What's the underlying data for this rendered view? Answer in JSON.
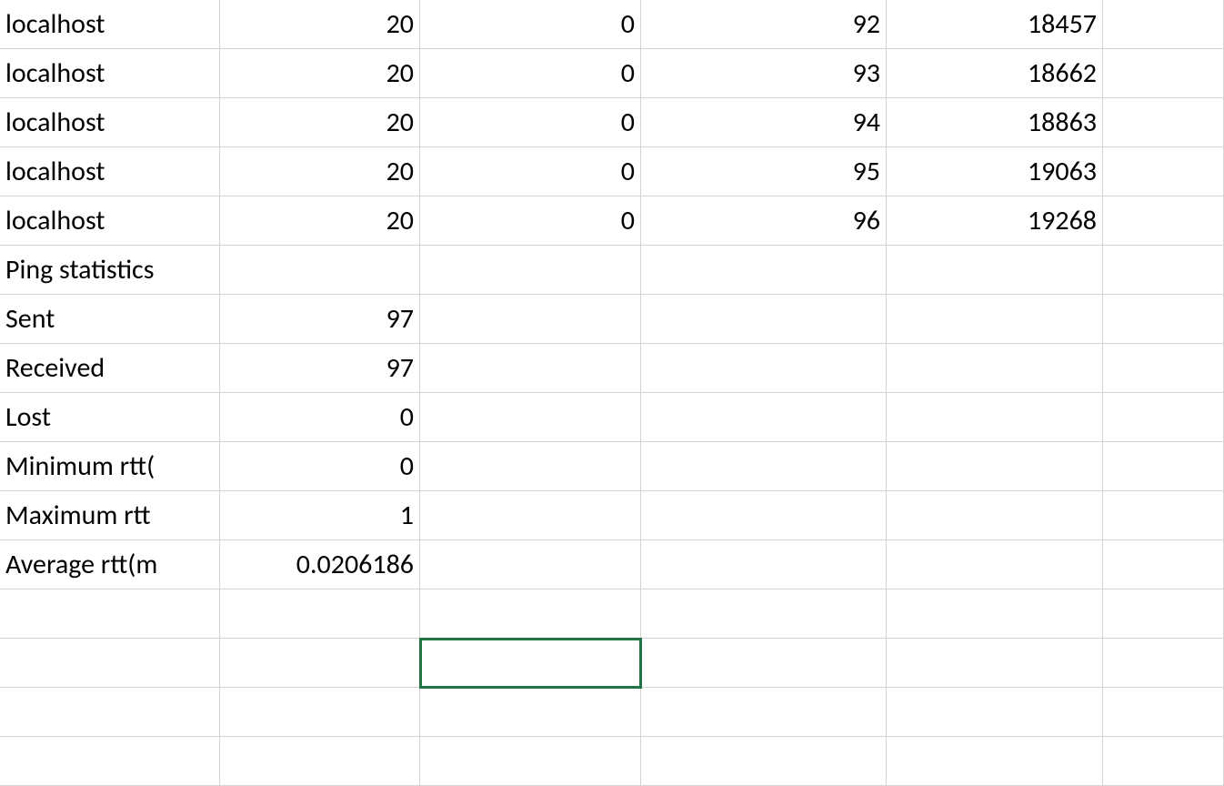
{
  "rows": [
    {
      "a": "localhost",
      "b": "20",
      "c": "0",
      "d": "92",
      "e": "18457",
      "f": ""
    },
    {
      "a": "localhost",
      "b": "20",
      "c": "0",
      "d": "93",
      "e": "18662",
      "f": ""
    },
    {
      "a": "localhost",
      "b": "20",
      "c": "0",
      "d": "94",
      "e": "18863",
      "f": ""
    },
    {
      "a": "localhost",
      "b": "20",
      "c": "0",
      "d": "95",
      "e": "19063",
      "f": ""
    },
    {
      "a": "localhost",
      "b": "20",
      "c": "0",
      "d": "96",
      "e": "19268",
      "f": ""
    },
    {
      "a": "Ping statistics",
      "b": "",
      "c": "",
      "d": "",
      "e": "",
      "f": ""
    },
    {
      "a": "Sent",
      "b": "97",
      "c": "",
      "d": "",
      "e": "",
      "f": ""
    },
    {
      "a": "Received",
      "b": "97",
      "c": "",
      "d": "",
      "e": "",
      "f": ""
    },
    {
      "a": "Lost",
      "b": "0",
      "c": "",
      "d": "",
      "e": "",
      "f": ""
    },
    {
      "a": "Minimum rtt(",
      "b": "0",
      "c": "",
      "d": "",
      "e": "",
      "f": ""
    },
    {
      "a": "Maximum rtt",
      "b": "1",
      "c": "",
      "d": "",
      "e": "",
      "f": ""
    },
    {
      "a": "Average rtt(m",
      "b": "0.0206186",
      "c": "",
      "d": "",
      "e": "",
      "f": ""
    },
    {
      "a": "",
      "b": "",
      "c": "",
      "d": "",
      "e": "",
      "f": ""
    },
    {
      "a": "",
      "b": "",
      "c": "",
      "d": "",
      "e": "",
      "f": ""
    },
    {
      "a": "",
      "b": "",
      "c": "",
      "d": "",
      "e": "",
      "f": ""
    },
    {
      "a": "",
      "b": "",
      "c": "",
      "d": "",
      "e": "",
      "f": ""
    }
  ],
  "selected": {
    "row": 13,
    "col": "c"
  }
}
